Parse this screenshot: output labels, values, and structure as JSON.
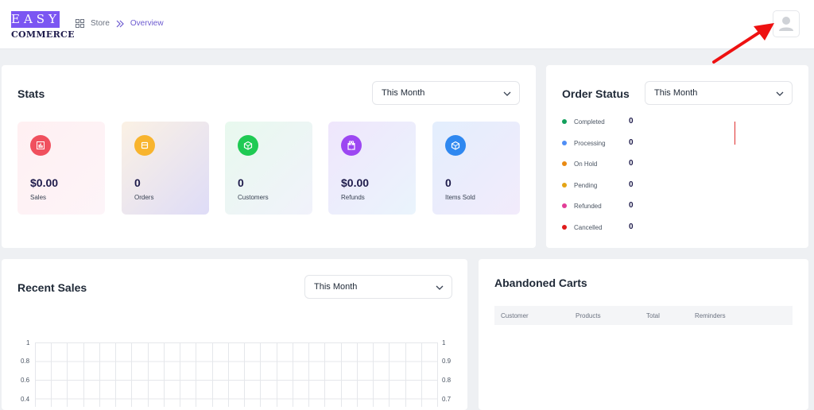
{
  "brand": {
    "logo_top": "EASY",
    "logo_bottom": "COMMERCE"
  },
  "breadcrumb": {
    "store": "Store",
    "current": "Overview"
  },
  "stats": {
    "title": "Stats",
    "filter": "This Month",
    "tiles": [
      {
        "value": "$0.00",
        "label": "Sales",
        "icon": "bar-chart-icon",
        "color": "#f0505e"
      },
      {
        "value": "0",
        "label": "Orders",
        "icon": "box-icon",
        "color": "#f8b42e"
      },
      {
        "value": "0",
        "label": "Customers",
        "icon": "cube-icon",
        "color": "#1fca53"
      },
      {
        "value": "$0.00",
        "label": "Refunds",
        "icon": "gift-icon",
        "color": "#9c47f2"
      },
      {
        "value": "0",
        "label": "Items Sold",
        "icon": "cube-icon",
        "color": "#2f88f0"
      }
    ]
  },
  "order_status": {
    "title": "Order Status",
    "filter": "This Month",
    "items": [
      {
        "label": "Completed",
        "value": "0",
        "color": "#12a05c"
      },
      {
        "label": "Processing",
        "value": "0",
        "color": "#4f8ef5"
      },
      {
        "label": "On Hold",
        "value": "0",
        "color": "#e98a13"
      },
      {
        "label": "Pending",
        "value": "0",
        "color": "#e4a415"
      },
      {
        "label": "Refunded",
        "value": "0",
        "color": "#e23d97"
      },
      {
        "label": "Cancelled",
        "value": "0",
        "color": "#e01b1b"
      }
    ]
  },
  "recent_sales": {
    "title": "Recent Sales",
    "filter": "This Month",
    "left_ticks": [
      "1",
      "0.8",
      "0.6",
      "0.4"
    ],
    "right_ticks": [
      "1",
      "0.9",
      "0.8",
      "0.7"
    ]
  },
  "abandoned_carts": {
    "title": "Abandoned Carts",
    "columns": [
      "Customer",
      "Products",
      "Total",
      "Reminders"
    ]
  },
  "colors": {
    "accent": "#7b56f2",
    "annotation_arrow": "#ee1111"
  }
}
